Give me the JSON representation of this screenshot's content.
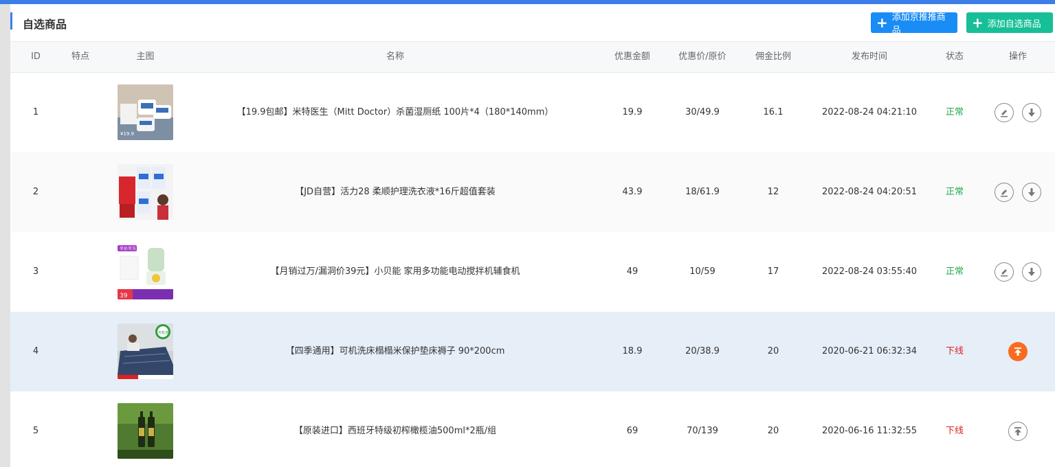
{
  "page": {
    "title": "自选商品"
  },
  "toolbar": {
    "add_jd_label": "添加京推推商品",
    "add_self_label": "添加自选商品"
  },
  "table": {
    "headers": {
      "id": "ID",
      "feature": "特点",
      "image": "主图",
      "name": "名称",
      "discount": "优惠金额",
      "price": "优惠价/原价",
      "commission": "佣金比例",
      "time": "发布时间",
      "status": "状态",
      "action": "操作"
    },
    "rows": [
      {
        "id": "1",
        "feature": "",
        "name": "【19.9包邮】米特医生（Mitt Doctor）杀菌湿厕纸 100片*4（180*140mm）",
        "discount": "19.9",
        "price": "30/49.9",
        "commission": "16.1",
        "time": "2022-08-24 04:21:10",
        "status": "正常"
      },
      {
        "id": "2",
        "feature": "",
        "name": "【JD自营】活力28 柔顺护理洗衣液*16斤超值套装",
        "discount": "43.9",
        "price": "18/61.9",
        "commission": "12",
        "time": "2022-08-24 04:20:51",
        "status": "正常"
      },
      {
        "id": "3",
        "feature": "",
        "name": "【月销过万/漏洞价39元】小贝能 家用多功能电动搅拌机辅食机",
        "discount": "49",
        "price": "10/59",
        "commission": "17",
        "time": "2022-08-24 03:55:40",
        "status": "正常"
      },
      {
        "id": "4",
        "feature": "",
        "name": "【四季通用】可机洗床榻榻米保护垫床褥子 90*200cm",
        "discount": "18.9",
        "price": "20/38.9",
        "commission": "20",
        "time": "2020-06-21 06:32:34",
        "status": "下线"
      },
      {
        "id": "5",
        "feature": "",
        "name": "【原装进口】西班牙特级初榨橄榄油500ml*2瓶/组",
        "discount": "69",
        "price": "70/139",
        "commission": "20",
        "time": "2020-06-16 11:32:55",
        "status": "下线"
      }
    ]
  },
  "thumb_text": {
    "row1_price": "¥19.9",
    "row3_tag": "半价半万",
    "row3_price": "39",
    "row4_badge": "可机洗"
  },
  "colors": {
    "accent": "#3c7ee8",
    "button_jd": "#1a8cf5",
    "button_self": "#16bf97",
    "status_ok": "#22a84a",
    "status_off": "#e02020",
    "publish_active": "#f96b1f"
  },
  "icons": {
    "edit": "edit-icon",
    "download": "download-icon",
    "publish": "publish-top-icon"
  }
}
